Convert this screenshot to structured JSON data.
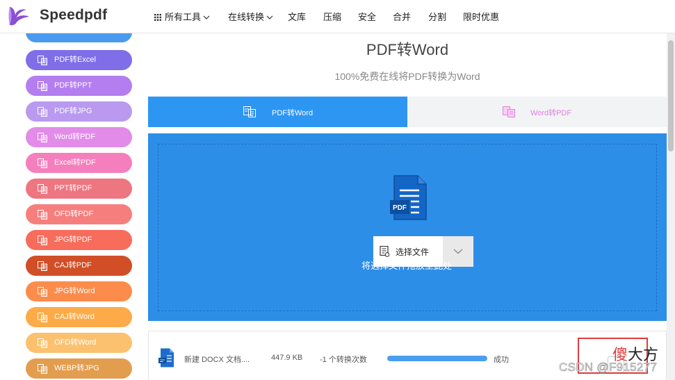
{
  "brand": {
    "name": "Speedpdf"
  },
  "nav": {
    "items": [
      {
        "label": "所有工具",
        "has_dropdown": true,
        "icon": "grid-icon"
      },
      {
        "label": "在线转换",
        "has_dropdown": true
      },
      {
        "label": "文库"
      },
      {
        "label": "压缩"
      },
      {
        "label": "安全"
      },
      {
        "label": "合并"
      },
      {
        "label": "分割"
      },
      {
        "label": "限时优惠"
      }
    ]
  },
  "sidebar": {
    "items": [
      {
        "label": "PDF转Excel",
        "color": "#7f6ee8"
      },
      {
        "label": "PDF转PPT",
        "color": "#b57ef0"
      },
      {
        "label": "PDF转JPG",
        "color": "#b99af0"
      },
      {
        "label": "Word转PDF",
        "color": "#e28be8"
      },
      {
        "label": "Excel转PDF",
        "color": "#f57fbd"
      },
      {
        "label": "PPT转PDF",
        "color": "#ee7680"
      },
      {
        "label": "OFD转PDF",
        "color": "#f67f7e"
      },
      {
        "label": "JPG转PDF",
        "color": "#f86c5c"
      },
      {
        "label": "CAJ转PDF",
        "color": "#d14e26"
      },
      {
        "label": "JPG转Word",
        "color": "#fb8c4c"
      },
      {
        "label": "CAJ转Word",
        "color": "#fdaa48"
      },
      {
        "label": "OFD转Word",
        "color": "#fcc16f"
      },
      {
        "label": "WEBP转JPG",
        "color": "#e39d4e"
      }
    ]
  },
  "main": {
    "title": "PDF转Word",
    "subtitle": "100%免费在线将PDF转换为Word",
    "tabs": [
      {
        "label": "PDF转Word",
        "active": true
      },
      {
        "label": "Word转PDF",
        "active": false
      }
    ],
    "upload": {
      "button_label": "选择文件",
      "hint": "将选择文件拖放至此处",
      "doc_badge": "PDF"
    },
    "file": {
      "name": "新建 DOCX 文档....",
      "size": "447.9 KB",
      "count_text": "-1 个转换次数",
      "progress": 1.0,
      "status": "成功"
    }
  },
  "watermark": {
    "name_red": "傻",
    "name_black": "大方",
    "csdn": "CSDN @F915277"
  },
  "colors": {
    "accent": "#2d96f3",
    "drop_bg": "#2d8ee8",
    "watermark_red": "#e03a3a"
  }
}
